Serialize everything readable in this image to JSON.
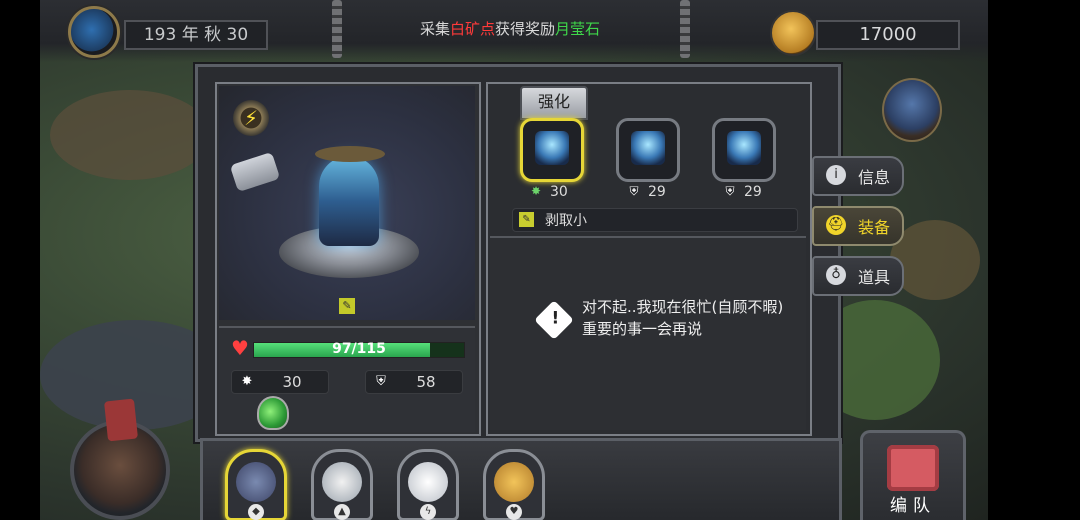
{
  "header": {
    "date": "193 年 秋 30",
    "notice_prefix": "采集",
    "notice_place": "白矿点",
    "notice_middle": "获得奖励",
    "notice_reward": "月莹石",
    "coins": "17000"
  },
  "hero": {
    "hp_text": "97/115",
    "hp_fraction": 0.84,
    "attack": "30",
    "defense": "58"
  },
  "equipment": {
    "tab_label": "强化",
    "slots": [
      {
        "stat": "30",
        "icon": "attack-icon"
      },
      {
        "stat": "29",
        "icon": "defense-icon"
      },
      {
        "stat": "29",
        "icon": "defense-icon"
      }
    ],
    "skill_label": "剥取小"
  },
  "message": {
    "text": "对不起..我现在很忙(自顾不暇)重要的事一会再说",
    "icon": "!"
  },
  "side_menu": {
    "info": "信息",
    "equip": "装备",
    "items": "道具"
  },
  "bottom": {
    "team_label": "编队"
  },
  "colors": {
    "accent_yellow": "#e6d637",
    "notice_red": "#ff3a3a",
    "notice_green": "#3fd74a",
    "hp_green": "#2aa54e"
  }
}
